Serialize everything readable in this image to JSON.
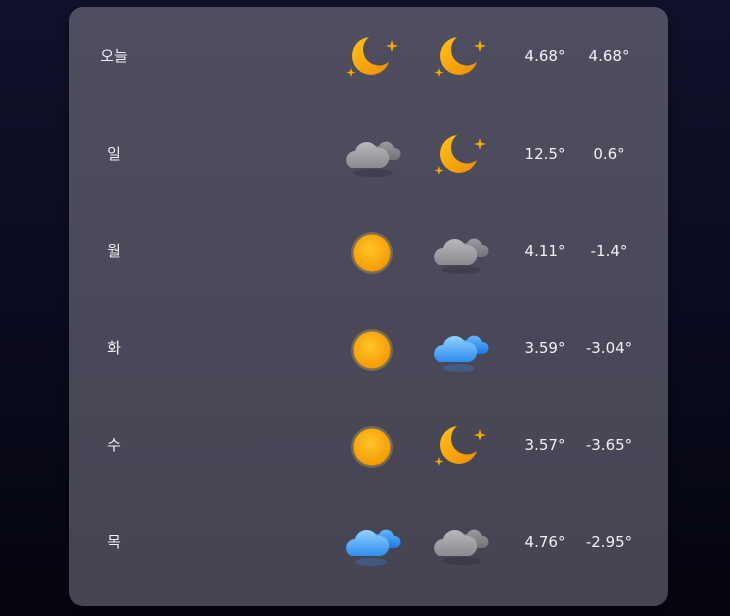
{
  "forecast": [
    {
      "day": "오늘",
      "am_icon": "moon-stars-icon",
      "pm_icon": "moon-stars-icon",
      "high": "4.68°",
      "low": "4.68°"
    },
    {
      "day": "일",
      "am_icon": "gray-cloud-icon",
      "pm_icon": "moon-stars-icon",
      "high": "12.5°",
      "low": "0.6°"
    },
    {
      "day": "월",
      "am_icon": "sun-icon",
      "pm_icon": "gray-cloud-icon",
      "high": "4.11°",
      "low": "-1.4°"
    },
    {
      "day": "화",
      "am_icon": "sun-icon",
      "pm_icon": "blue-cloud-icon",
      "high": "3.59°",
      "low": "-3.04°"
    },
    {
      "day": "수",
      "am_icon": "sun-icon",
      "pm_icon": "moon-stars-icon",
      "high": "3.57°",
      "low": "-3.65°"
    },
    {
      "day": "목",
      "am_icon": "blue-cloud-icon",
      "pm_icon": "gray-cloud-icon",
      "high": "4.76°",
      "low": "-2.95°"
    }
  ],
  "colors": {
    "moon": "#f6a300",
    "sun": "#ffae00",
    "gray_cloud": "#9a9ba0",
    "blue_cloud": "#3f9fff"
  }
}
